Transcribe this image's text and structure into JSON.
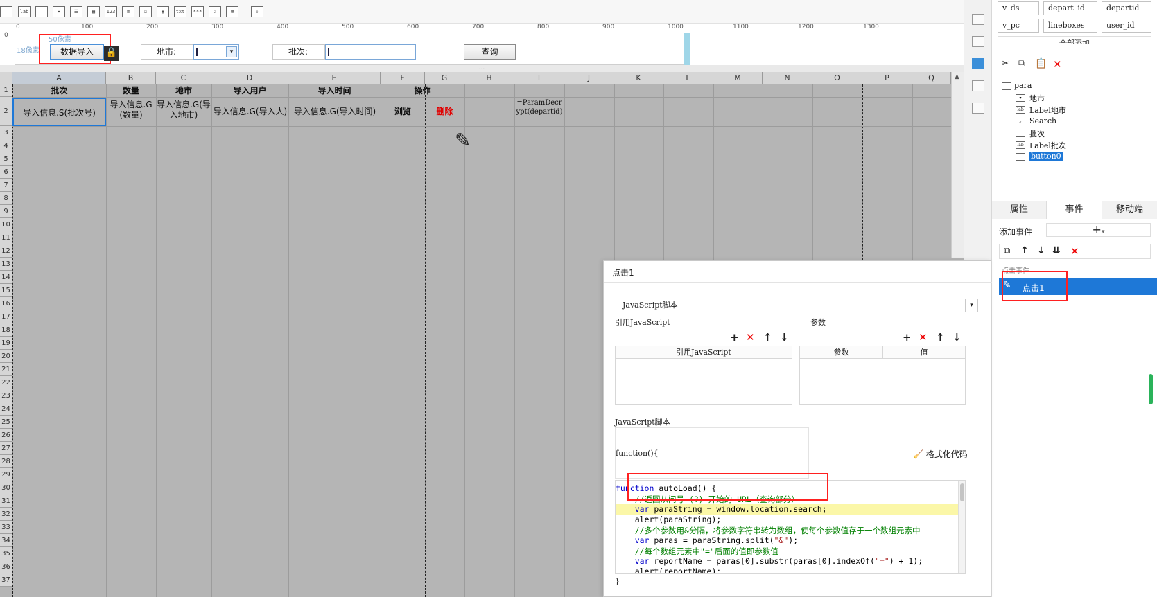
{
  "toolbar": {
    "icons": [
      "text-widget",
      "label-widget",
      "button-widget",
      "combo-widget",
      "list-widget",
      "date-widget",
      "number-widget",
      "textarea-widget",
      "checkbox-group-widget",
      "radio-group-widget",
      "password-widget",
      "file-widget",
      "checkbox-widget",
      "tree-widget",
      "file-upload-widget"
    ],
    "icon_texts": [
      "lab",
      "123",
      "txt",
      "***"
    ]
  },
  "ruler": {
    "ticks": [
      "0",
      "100",
      "200",
      "300",
      "400",
      "500",
      "600",
      "700",
      "800",
      "900",
      "1000",
      "1100",
      "1200",
      "1300"
    ],
    "left": "0"
  },
  "param_area": {
    "hint_top": "50像素",
    "hint_left": "18像素",
    "import_button": "数据导入",
    "city_label": "地市:",
    "batch_label": "批次:",
    "query_button": "查询"
  },
  "splitter": "...",
  "sheet": {
    "columns": [
      "A",
      "B",
      "C",
      "D",
      "E",
      "F",
      "G",
      "H",
      "I",
      "J",
      "K",
      "L",
      "M",
      "N",
      "O",
      "P",
      "Q"
    ],
    "rows": [
      "1",
      "2",
      "3",
      "4",
      "5",
      "6",
      "7",
      "8",
      "9",
      "10",
      "11",
      "12",
      "13",
      "14",
      "15",
      "16",
      "17",
      "18",
      "19",
      "20",
      "21",
      "22",
      "23",
      "24",
      "25",
      "26",
      "27",
      "28",
      "29",
      "30",
      "31",
      "32",
      "33",
      "34",
      "35",
      "36",
      "37"
    ],
    "header_row": {
      "a": "批次",
      "b": "数量",
      "c": "地市",
      "d": "导入用户",
      "e": "导入时间",
      "f": "操作"
    },
    "data_row": {
      "a": "导入信息.S(批次号)",
      "b": "导入信息.G(数量)",
      "c": "导入信息.G(导入地市)",
      "d": "导入信息.G(导入人)",
      "e": "导入信息.G(导入时间)",
      "f": "浏览",
      "g": "删除",
      "i": "=ParamDecrypt(departid)"
    }
  },
  "right_panel": {
    "datasets": [
      "v_ds",
      "depart_id",
      "departid",
      "v_pc",
      "lineboxes",
      "user_id"
    ],
    "add_all": "全部添加",
    "tree_root": "para",
    "tree_items": [
      "地市",
      "Label地市",
      "Search",
      "批次",
      "Label批次",
      "button0"
    ],
    "tabs": [
      "属性",
      "事件",
      "移动端"
    ],
    "add_event_label": "添加事件",
    "add_event_symbol": "+",
    "event_group": "点击事件",
    "event_item": "点击1"
  },
  "dialog": {
    "title": "点击1",
    "type_select": "JavaScript脚本",
    "ref_js_label": "引用JavaScript",
    "params_label": "参数",
    "ref_js_header": "引用JavaScript",
    "params_header": "参数",
    "value_header": "值",
    "script_label": "JavaScript脚本",
    "func_open": "function(){",
    "format_code": "格式化代码",
    "func_close": "}",
    "code_lines": [
      "function autoLoad() {",
      "    //返回从问号 (?) 开始的 URL（查询部分）",
      "    var paraString = window.location.search;",
      "    alert(paraString);",
      "    //多个参数用&分隔，将参数字符串转为数组，使每个参数值存于一个数组元素中",
      "    var paras = paraString.split(\"&\");",
      "    //每个数组元素中\"=\"后面的值即参数值",
      "    var reportName = paras[0].substr(paras[0].indexOf(\"=\") + 1);",
      "    alert(reportName);"
    ]
  },
  "colors": {
    "sheet_bg": "#b5b5b5",
    "highlight_red": "#ff2020",
    "selection_blue": "#1e78d7",
    "delete_red": "#e00000"
  }
}
